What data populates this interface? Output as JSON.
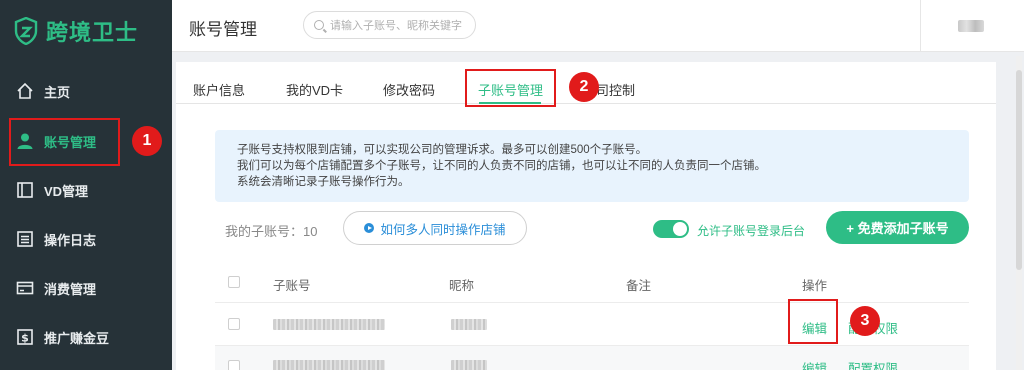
{
  "app": {
    "logo_text": "跨境卫士",
    "brand_color": "#2ebd86"
  },
  "sidebar": {
    "items": [
      {
        "label": "主页",
        "icon": "home-icon"
      },
      {
        "label": "账号管理",
        "icon": "user-icon",
        "active": true
      },
      {
        "label": "VD管理",
        "icon": "window-icon"
      },
      {
        "label": "操作日志",
        "icon": "list-icon"
      },
      {
        "label": "消费管理",
        "icon": "card-icon"
      },
      {
        "label": "推广赚金豆",
        "icon": "dollar-icon"
      }
    ]
  },
  "header": {
    "title": "账号管理",
    "search_placeholder": "请输入子账号、昵称关键字"
  },
  "tabs": [
    {
      "label": "账户信息"
    },
    {
      "label": "我的VD卡"
    },
    {
      "label": "修改密码"
    },
    {
      "label": "子账号管理",
      "active": true
    },
    {
      "label": "司控制"
    }
  ],
  "info": {
    "lines": [
      "子账号支持权限到店铺，可以实现公司的管理诉求。最多可以创建500个子账号。",
      "我们可以为每个店铺配置多个子账号，让不同的人负责不同的店铺，也可以让不同的人负责同一个店铺。",
      "系统会清晰记录子账号操作行为。"
    ]
  },
  "toolbar": {
    "my_count_label": "我的子账号：10",
    "how_label": "如何多人同时操作店铺",
    "toggle_label": "允许子账号登录后台",
    "toggle_on": true,
    "add_label": "+ 免费添加子账号"
  },
  "table": {
    "headers": [
      "子账号",
      "昵称",
      "备注",
      "操作"
    ],
    "rows": [
      {
        "actions": [
          "编辑",
          "配置权限"
        ]
      },
      {
        "actions": [
          "编辑",
          "配置权限"
        ]
      }
    ]
  },
  "annotations": [
    "1",
    "2",
    "3"
  ],
  "annotation_color": "#e11b1b"
}
